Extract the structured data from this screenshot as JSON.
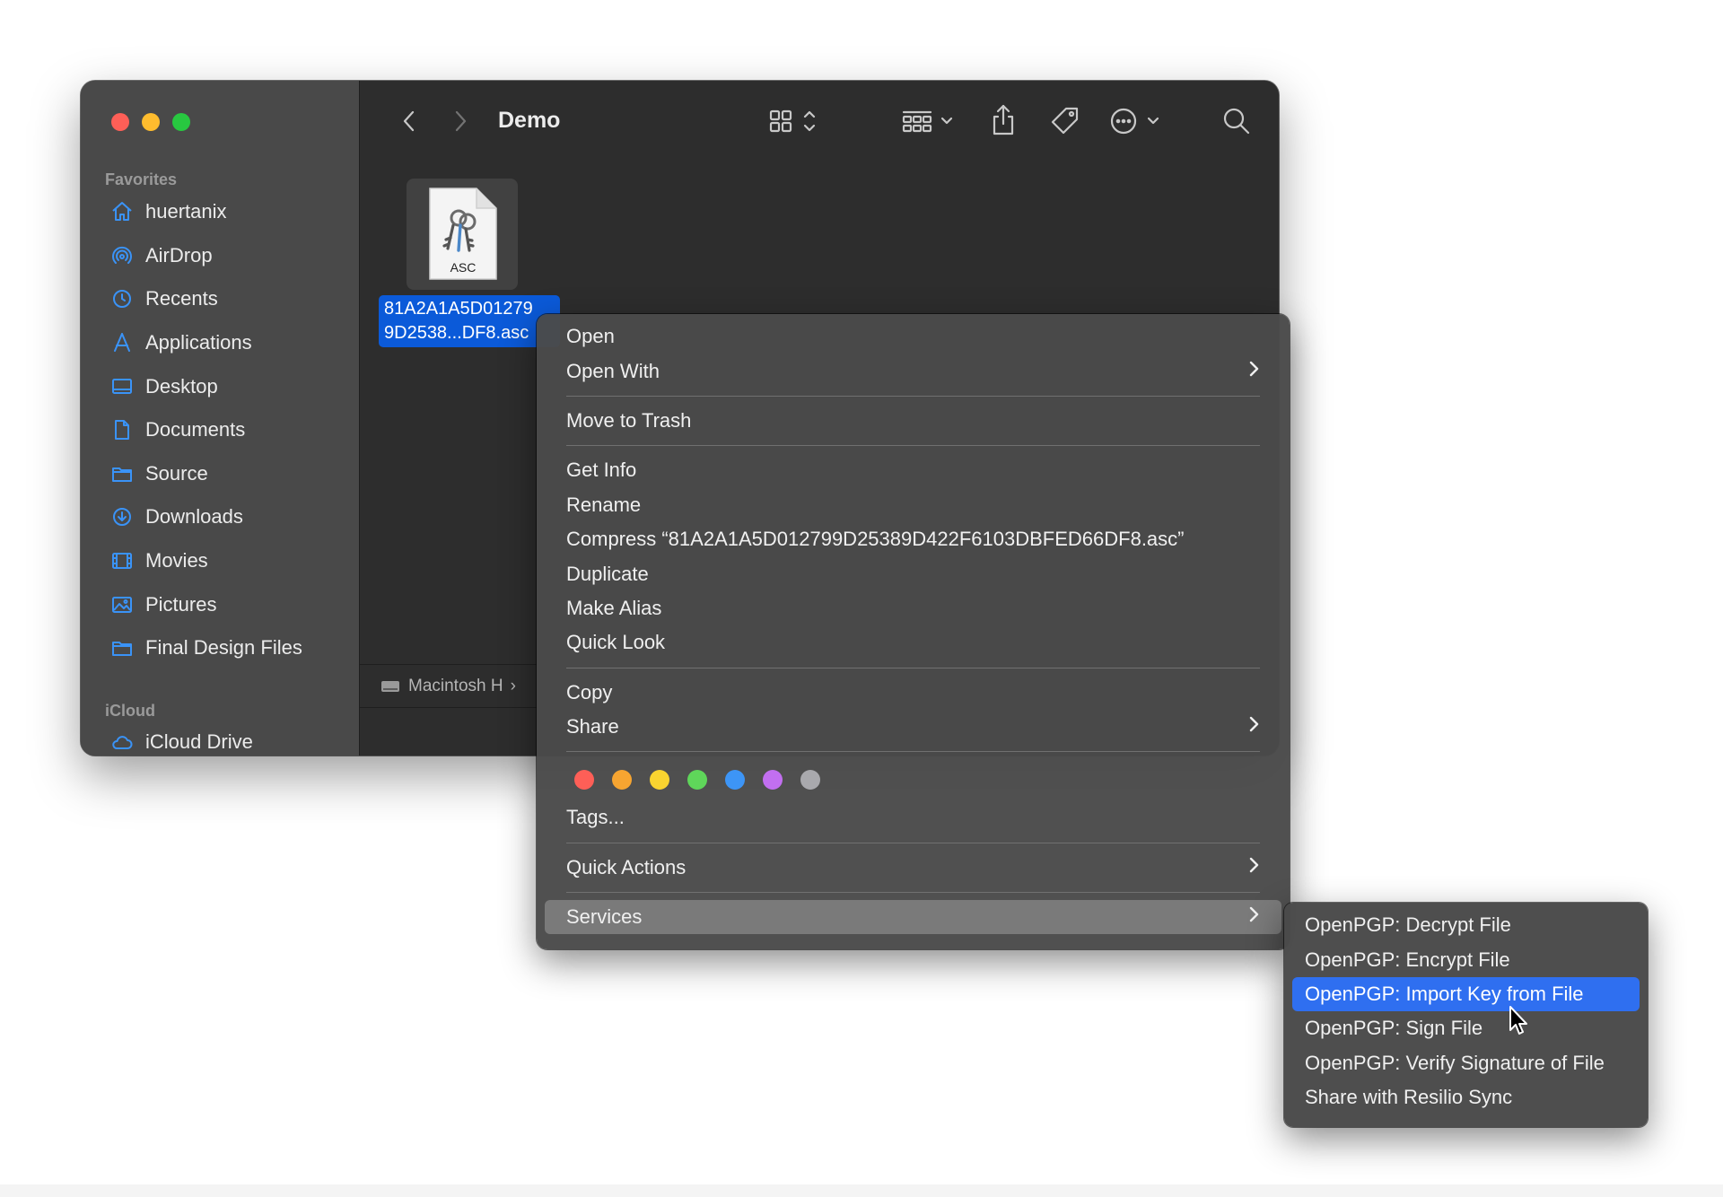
{
  "window": {
    "title": "Demo",
    "sidebar": {
      "favorites_label": "Favorites",
      "items": [
        {
          "label": "huertanix",
          "icon": "home-icon"
        },
        {
          "label": "AirDrop",
          "icon": "airdrop-icon"
        },
        {
          "label": "Recents",
          "icon": "clock-icon"
        },
        {
          "label": "Applications",
          "icon": "applications-icon"
        },
        {
          "label": "Desktop",
          "icon": "desktop-icon"
        },
        {
          "label": "Documents",
          "icon": "document-icon"
        },
        {
          "label": "Source",
          "icon": "folder-icon"
        },
        {
          "label": "Downloads",
          "icon": "download-icon"
        },
        {
          "label": "Movies",
          "icon": "film-icon"
        },
        {
          "label": "Pictures",
          "icon": "photo-icon"
        },
        {
          "label": "Final Design Files",
          "icon": "folder-icon"
        }
      ],
      "icloud_label": "iCloud",
      "icloud_items": [
        {
          "label": "iCloud Drive",
          "icon": "cloud-icon"
        }
      ]
    },
    "file": {
      "name_line1": "81A2A1A5D01279",
      "name_line2": "9D2538...DF8.asc",
      "type_badge": "ASC"
    },
    "pathbar": {
      "disk": "Macintosh H",
      "separator": "›"
    }
  },
  "context_menu": {
    "open": "Open",
    "open_with": "Open With",
    "move_to_trash": "Move to Trash",
    "get_info": "Get Info",
    "rename": "Rename",
    "compress": "Compress “81A2A1A5D012799D25389D422F6103DBFED66DF8.asc”",
    "duplicate": "Duplicate",
    "make_alias": "Make Alias",
    "quick_look": "Quick Look",
    "copy": "Copy",
    "share": "Share",
    "tag_colors": [
      "#fe5f57",
      "#f7a531",
      "#f9d430",
      "#5fd65a",
      "#3d95f6",
      "#c26ff0",
      "#a9a9ad"
    ],
    "tags": "Tags...",
    "quick_actions": "Quick Actions",
    "services": "Services"
  },
  "services_submenu": {
    "items": [
      "OpenPGP: Decrypt File",
      "OpenPGP: Encrypt File",
      "OpenPGP: Import Key from File",
      "OpenPGP: Sign File",
      "OpenPGP: Verify Signature of File",
      "Share with Resilio Sync"
    ],
    "selected_index": 2
  }
}
